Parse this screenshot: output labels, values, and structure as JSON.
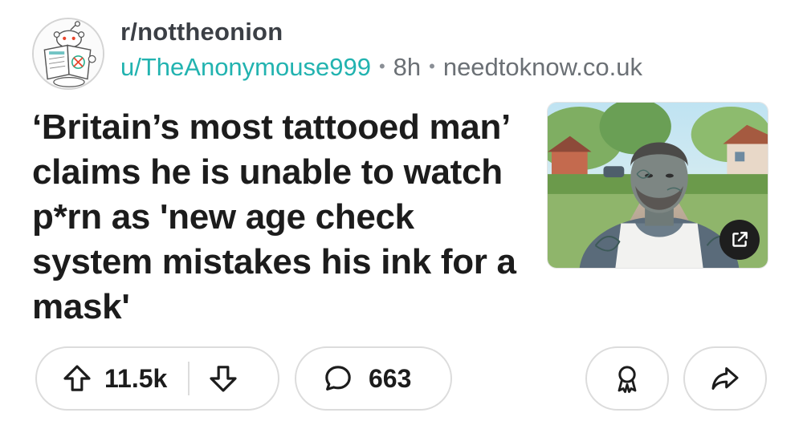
{
  "post": {
    "subreddit": "r/nottheonion",
    "username": "u/TheAnonymouse999",
    "separator": "•",
    "age": "8h",
    "domain": "needtoknow.co.uk",
    "title": "‘Britain’s most tattooed man’ claims he is unable to watch p*rn as 'new age check system mistakes his ink for a mask'",
    "thumbnail_icon": "external-link-icon"
  },
  "actions": {
    "upvotes": "11.5k",
    "comments": "663",
    "upvote_icon": "arrow-up-icon",
    "downvote_icon": "arrow-down-icon",
    "comment_icon": "speech-bubble-icon",
    "award_icon": "award-ribbon-icon",
    "share_icon": "share-arrow-icon"
  },
  "colors": {
    "username": "#22b3b0",
    "meta_gray": "#6b7075",
    "title": "#1c1c1c",
    "pill_border": "#dcdcdc"
  }
}
